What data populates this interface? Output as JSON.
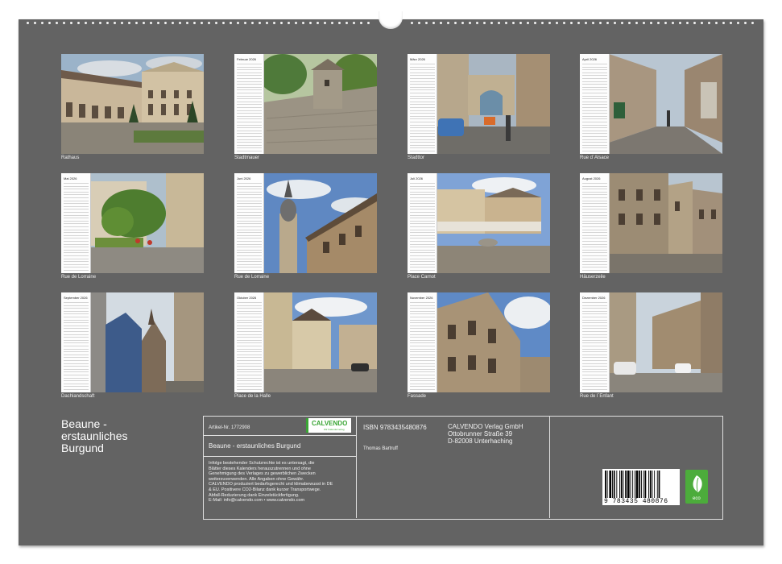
{
  "product": {
    "title_lines": [
      "Beaune -",
      "erstaunliches",
      "Burgund"
    ]
  },
  "colors": {
    "board": "#636363",
    "accent_green": "#3aa535"
  },
  "pages": [
    {
      "caption": "Rathaus",
      "month": ""
    },
    {
      "caption": "Stadtmauer",
      "month": "Februar 2026"
    },
    {
      "caption": "Stadttor",
      "month": "März 2026"
    },
    {
      "caption": "Rue d´Alsace",
      "month": "April 2026"
    },
    {
      "caption": "Rue de Lorraine",
      "month": "Mai 2026"
    },
    {
      "caption": "Rue de Lorraine",
      "month": "Juni 2026"
    },
    {
      "caption": "Place Carnot",
      "month": "Juli 2026"
    },
    {
      "caption": "Häuserzeile",
      "month": "August 2026"
    },
    {
      "caption": "Dachlandschaft",
      "month": "September 2026"
    },
    {
      "caption": "Place de la Halle",
      "month": "Oktober 2026"
    },
    {
      "caption": "Fassade",
      "month": "November 2026"
    },
    {
      "caption": "Rue de l´Enfant",
      "month": "Dezember 2026"
    }
  ],
  "info": {
    "article_label": "Artikel-Nr. 1772908",
    "logo_text": "CALVENDO",
    "logo_sub": "Wir Kalenderverlag",
    "product_title": "Beaune - erstaunliches Burgund",
    "legal_lines": [
      "Infolge bestehender Schutzrechte ist es untersagt, die",
      "Blätter dieses Kalenders herauszutrennen und ohne",
      "Genehmigung des Verlages zu gewerblichen Zwecken",
      "weiterzuverwenden. Alle Angaben ohne Gewähr.",
      "CALVENDO produziert bedarfsgerecht und klimabewusst in DE",
      "& EU. Positivere CO2-Bilanz dank kurzer Transportwege.",
      "Abfall-Reduzierung dank Einzelstückfertigung.",
      "E-Mail: info@calvendo.com • www.calvendo.com"
    ],
    "isbn": "ISBN 9783435480876",
    "author": "Thomas Bartruff",
    "publisher_lines": [
      "CALVENDO Verlag GmbH",
      "Ottobrunner Straße 39",
      "D-82008 Unterhaching"
    ],
    "barcode_digits": "9 783435 480876",
    "eco_label": "eco"
  }
}
